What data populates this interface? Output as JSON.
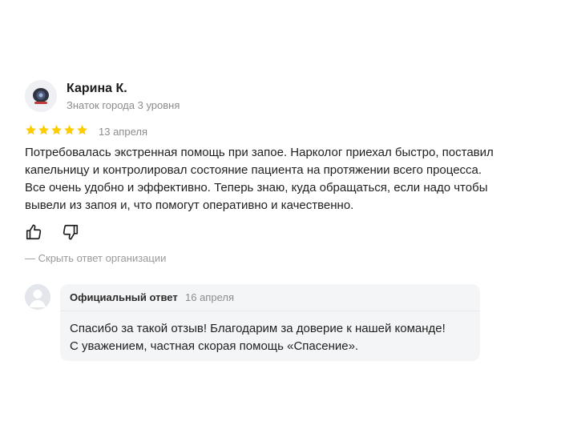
{
  "review": {
    "author": {
      "name": "Карина К.",
      "level": "Знаток города 3 уровня"
    },
    "rating": 5,
    "star_color": "#ffcc00",
    "date": "13 апреля",
    "text_lines": [
      "Потребовалась экстренная помощь при запое. Нарколог приехал быстро, поставил",
      "капельницу и контролировал состояние пациента на протяжении всего процесса.",
      "Все очень удобно и эффективно. Теперь знаю, куда обращаться, если надо чтобы",
      "вывели из запоя и, что помогут оперативно и качественно."
    ],
    "actions": {
      "like_icon": "thumbs-up-icon",
      "dislike_icon": "thumbs-down-icon"
    },
    "hide_answer_label": "— Скрыть ответ организации"
  },
  "org_answer": {
    "title": "Официальный ответ",
    "date": "16 апреля",
    "text_lines": [
      "Спасибо за такой отзыв! Благодарим за доверие к нашей команде!",
      "С уважением, частная скорая помощь «Спасение»."
    ]
  }
}
